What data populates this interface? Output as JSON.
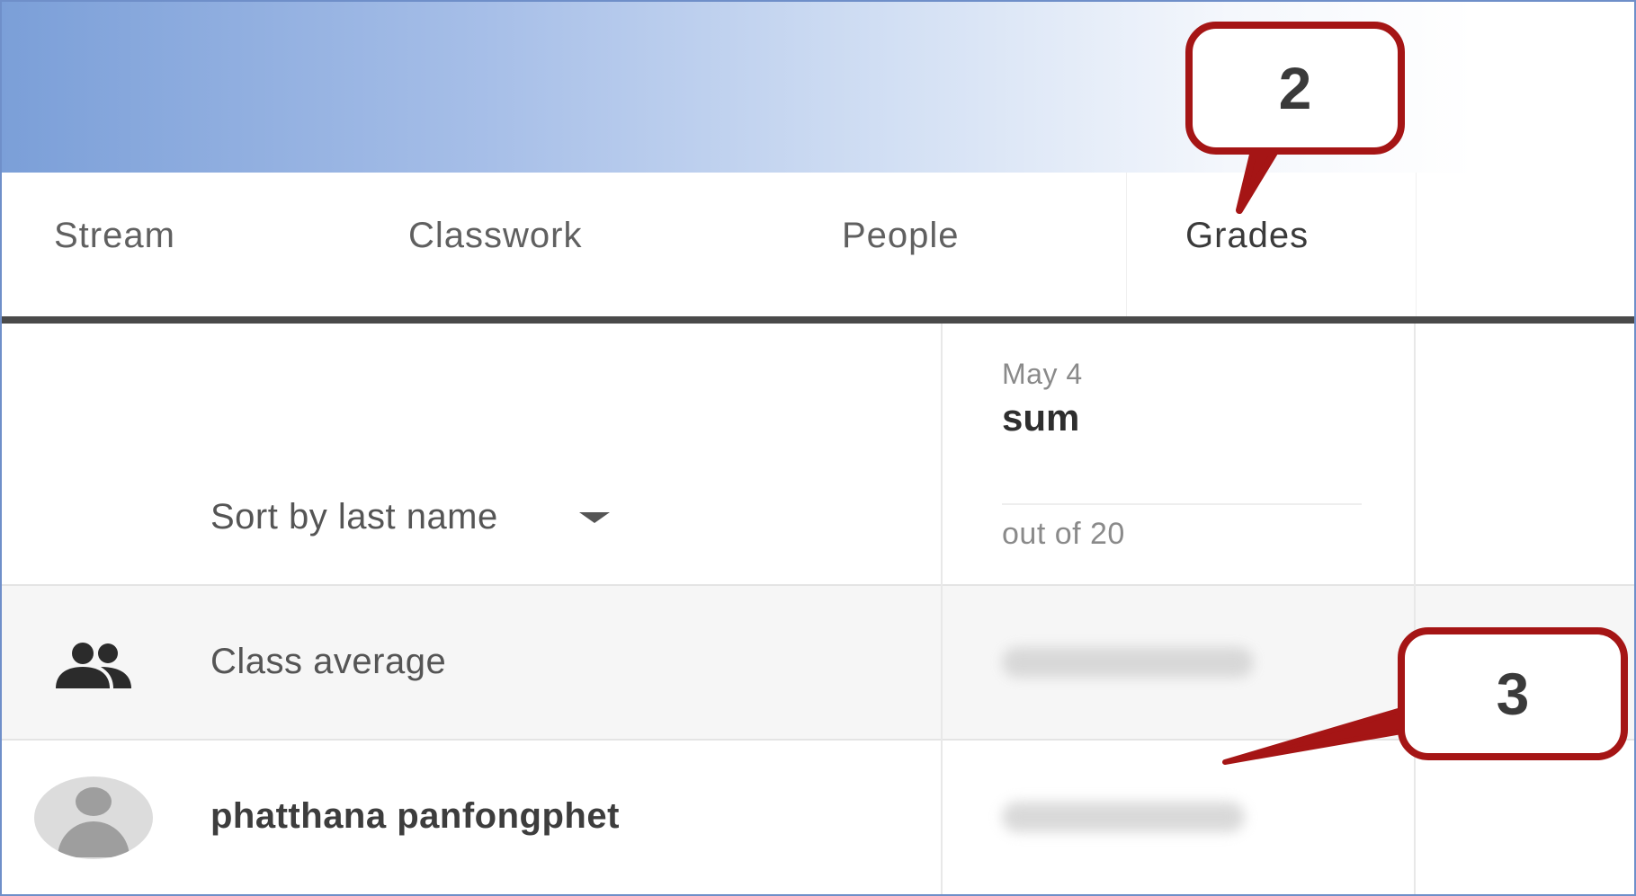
{
  "tabs": [
    {
      "label": "Stream"
    },
    {
      "label": "Classwork"
    },
    {
      "label": "People"
    },
    {
      "label": "Grades"
    }
  ],
  "active_tab": "Grades",
  "sort": {
    "label": "Sort by last name",
    "icon": "caret-down-icon"
  },
  "assignment": {
    "date": "May 4",
    "title": "sum",
    "points": "out of 20"
  },
  "rows": {
    "average": {
      "label": "Class average",
      "icon": "people-icon"
    },
    "student": {
      "name": "phatthana panfongphet",
      "icon": "avatar-icon"
    }
  },
  "callouts": {
    "two": "2",
    "three": "3"
  },
  "colors": {
    "callout_border": "#a51515",
    "tab_underline": "#4a4a4a",
    "banner_start": "#7b9fd8"
  }
}
